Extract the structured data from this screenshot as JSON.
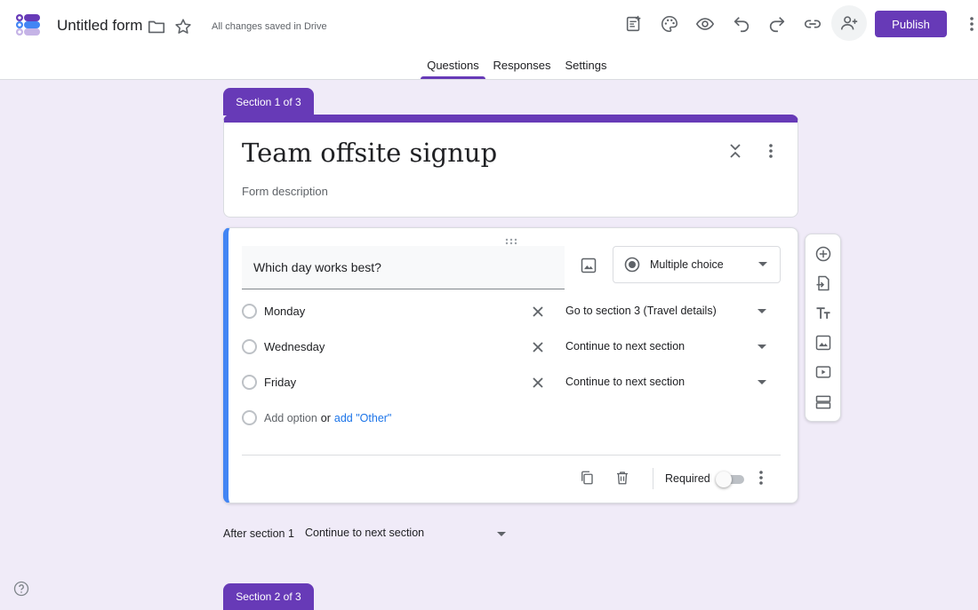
{
  "header": {
    "form_title": "Untitled form",
    "save_status": "All changes saved in Drive",
    "publish_label": "Publish",
    "toolbar_icons": [
      "customize-theme-addon-icon",
      "palette-icon",
      "preview-eye-icon",
      "undo-icon",
      "redo-icon",
      "link-icon",
      "add-collaborator-icon",
      "more-vert-icon"
    ]
  },
  "tabs": [
    {
      "label": "Questions",
      "active": true
    },
    {
      "label": "Responses",
      "active": false
    },
    {
      "label": "Settings",
      "active": false
    }
  ],
  "sections": {
    "section1_label": "Section 1 of 3",
    "section2_label": "Section 2 of 3"
  },
  "title_card": {
    "title": "Team offsite signup",
    "description_placeholder": "Form description"
  },
  "question": {
    "text": "Which day works best?",
    "type": "Multiple choice",
    "options": [
      {
        "label": "Monday",
        "goto": "Go to section 3 (Travel details)"
      },
      {
        "label": "Wednesday",
        "goto": "Continue to next section"
      },
      {
        "label": "Friday",
        "goto": "Continue to next section"
      }
    ],
    "add_option": "Add option",
    "or": "or",
    "add_other": "add \"Other\"",
    "required_label": "Required",
    "required": false
  },
  "after_section": {
    "label": "After section 1",
    "value": "Continue to next section"
  },
  "colors": {
    "accent": "#673ab7",
    "active_card_border": "#4285f4",
    "background": "#f0ebf8",
    "link": "#1a73e8"
  }
}
